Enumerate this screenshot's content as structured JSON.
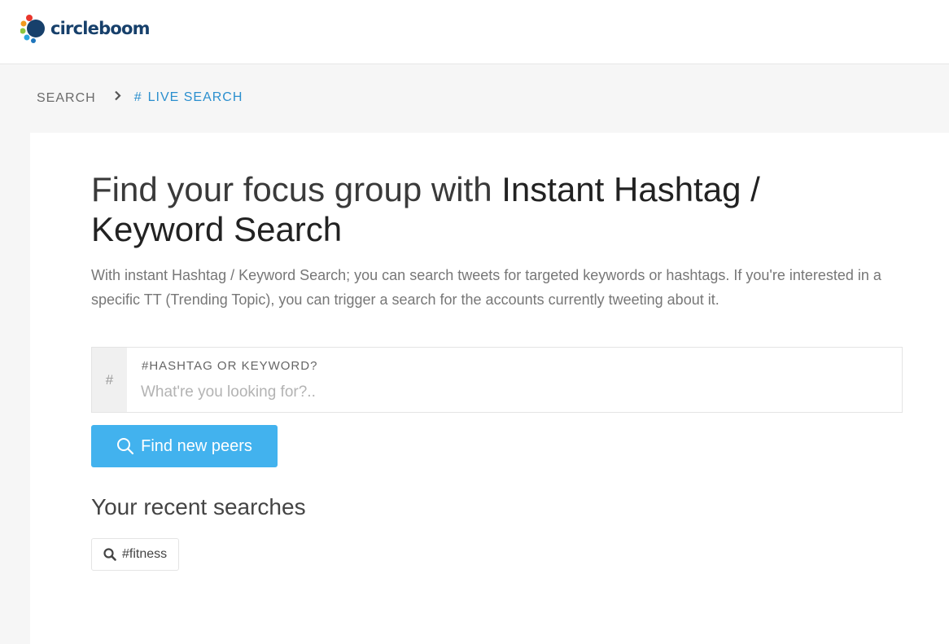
{
  "brand": {
    "name": "circleboom"
  },
  "breadcrumb": {
    "items": [
      {
        "label": "SEARCH"
      },
      {
        "label": "LIVE SEARCH",
        "icon": "#"
      }
    ],
    "separator_icon": "chevron-right-icon"
  },
  "main": {
    "headline_light": "Find your focus group with ",
    "headline_bold": "Instant Hashtag / Keyword Search",
    "description": "With instant Hashtag / Keyword Search; you can search tweets for targeted keywords or hashtags. If you're interested in a specific TT (Trending Topic), you can trigger a search for the accounts currently tweeting about it.",
    "search": {
      "prefix": "#",
      "label": "#HASHTAG OR KEYWORD?",
      "placeholder": "What're you looking for?..",
      "value": ""
    },
    "find_button_label": "Find new peers",
    "recent_title": "Your recent searches",
    "recent_searches": [
      {
        "label": "#fitness",
        "icon": "search-icon"
      }
    ]
  },
  "colors": {
    "accent": "#42b2ee",
    "link": "#2b8fce",
    "brand_text": "#17406b"
  }
}
